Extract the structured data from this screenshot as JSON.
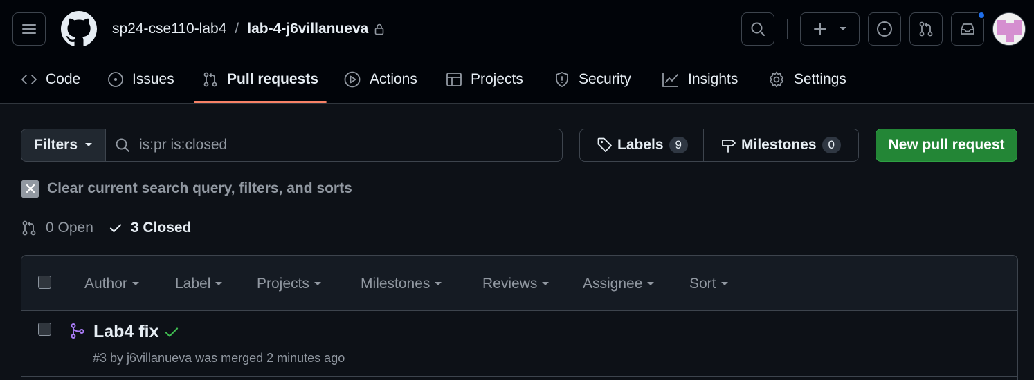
{
  "header": {
    "owner": "sp24-cse110-lab4",
    "separator": "/",
    "repo": "lab-4-j6villanueva",
    "has_notification": true
  },
  "tabs": [
    {
      "label": "Code",
      "icon": "code-icon"
    },
    {
      "label": "Issues",
      "icon": "issue-opened-icon"
    },
    {
      "label": "Pull requests",
      "icon": "git-pull-request-icon",
      "selected": true
    },
    {
      "label": "Actions",
      "icon": "play-icon"
    },
    {
      "label": "Projects",
      "icon": "table-icon"
    },
    {
      "label": "Security",
      "icon": "shield-icon"
    },
    {
      "label": "Insights",
      "icon": "graph-icon"
    },
    {
      "label": "Settings",
      "icon": "gear-icon"
    }
  ],
  "filterbar": {
    "filters_label": "Filters",
    "search_value": "is:pr is:closed",
    "labels_label": "Labels",
    "labels_count": "9",
    "milestones_label": "Milestones",
    "milestones_count": "0",
    "new_pr_label": "New pull request"
  },
  "clear_query_label": "Clear current search query, filters, and sorts",
  "states": {
    "open_label": "0 Open",
    "closed_label": "3 Closed"
  },
  "list_filters": [
    "Author",
    "Label",
    "Projects",
    "Milestones",
    "Reviews",
    "Assignee",
    "Sort"
  ],
  "pull_requests": [
    {
      "title": "Lab4 fix",
      "meta": "#3 by j6villanueva was merged 2 minutes ago",
      "status": "merged",
      "checks": "passed"
    }
  ],
  "colors": {
    "accent_underline": "#f78166",
    "primary_button": "#238636",
    "merged": "#ab7df8",
    "success": "#3fb950",
    "notification": "#1f6feb"
  }
}
